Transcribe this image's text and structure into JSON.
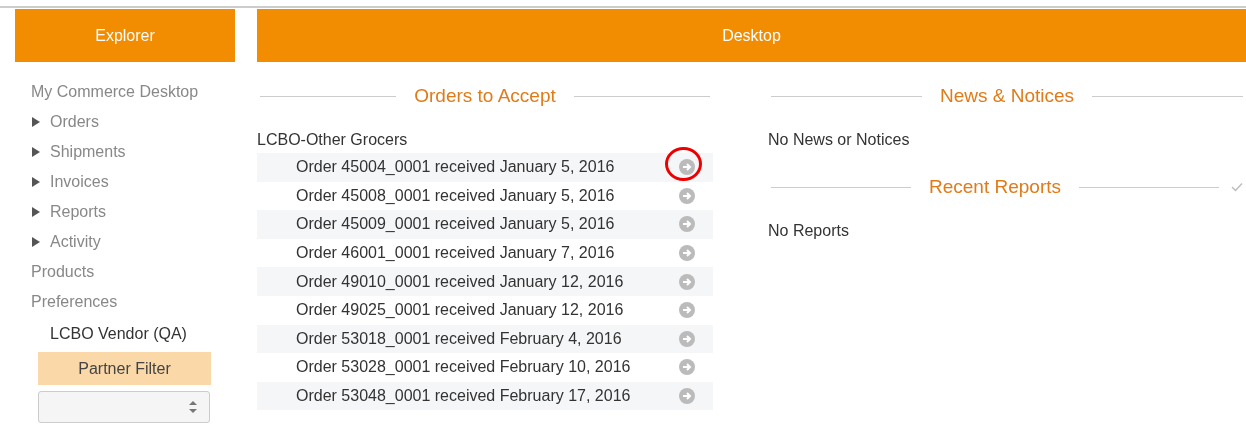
{
  "explorer": {
    "title": "Explorer",
    "items": [
      {
        "kind": "link",
        "label": "My Commerce Desktop"
      },
      {
        "kind": "group",
        "label": "Orders",
        "expanded": false
      },
      {
        "kind": "group",
        "label": "Shipments",
        "expanded": false
      },
      {
        "kind": "group",
        "label": "Invoices",
        "expanded": false
      },
      {
        "kind": "group",
        "label": "Reports",
        "expanded": false
      },
      {
        "kind": "group",
        "label": "Activity",
        "expanded": false
      },
      {
        "kind": "link",
        "label": "Products"
      },
      {
        "kind": "link",
        "label": "Preferences"
      }
    ],
    "vendor": "LCBO Vendor (QA)",
    "partner_filter": {
      "title": "Partner Filter"
    }
  },
  "desktop": {
    "title": "Desktop",
    "orders": {
      "title": "Orders to Accept",
      "partner": "LCBO-Other Grocers",
      "rows": [
        {
          "text": "Order 45004_0001 received January 5, 2016",
          "highlighted": true
        },
        {
          "text": "Order 45008_0001 received January 5, 2016",
          "highlighted": false
        },
        {
          "text": "Order 45009_0001 received January 5, 2016",
          "highlighted": false
        },
        {
          "text": "Order 46001_0001 received January 7, 2016",
          "highlighted": false
        },
        {
          "text": "Order 49010_0001 received January 12, 2016",
          "highlighted": false
        },
        {
          "text": "Order 49025_0001 received January 12, 2016",
          "highlighted": false
        },
        {
          "text": "Order 53018_0001 received February 4, 2016",
          "highlighted": false
        },
        {
          "text": "Order 53028_0001 received February 10, 2016",
          "highlighted": false
        },
        {
          "text": "Order 53048_0001 received February 17, 2016",
          "highlighted": false
        }
      ]
    },
    "news": {
      "title": "News & Notices",
      "message": "No News or Notices"
    },
    "reports": {
      "title": "Recent Reports",
      "message": "No Reports"
    }
  }
}
